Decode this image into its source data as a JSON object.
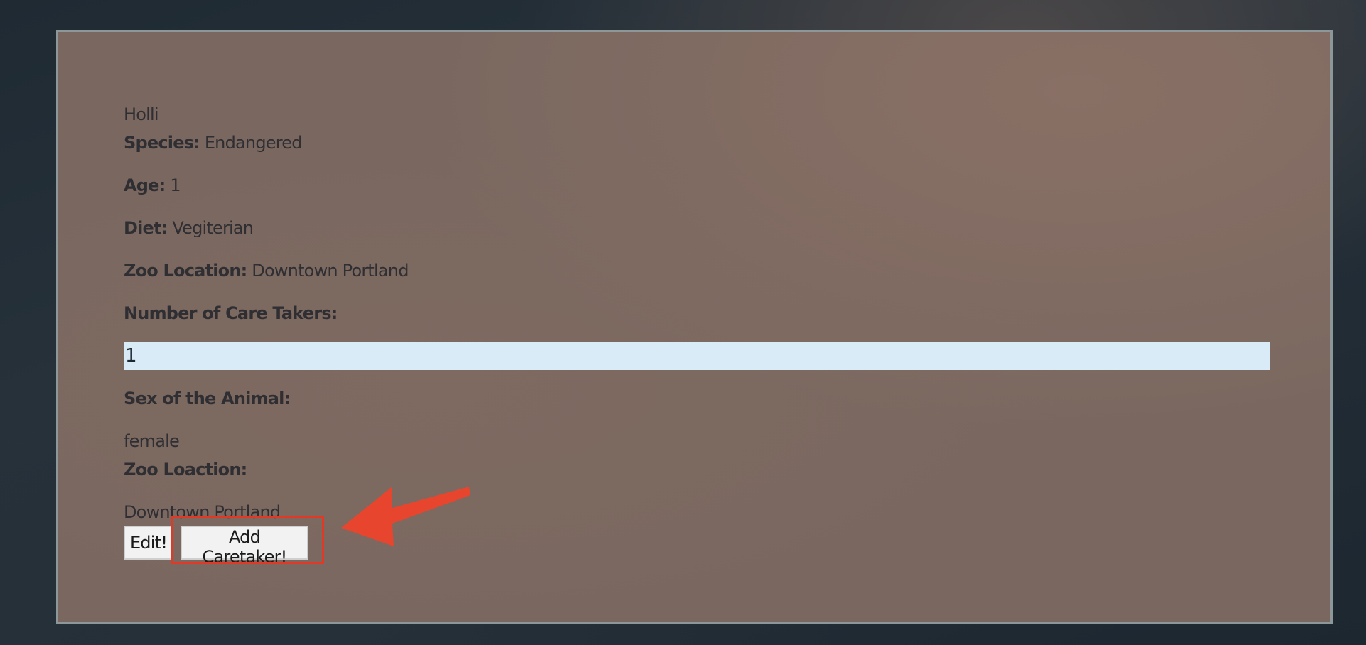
{
  "animal": {
    "name": "Holli",
    "species_label": "Species:",
    "species_value": "Endangered",
    "age_label": "Age:",
    "age_value": "1",
    "diet_label": "Diet:",
    "diet_value": "Vegiterian",
    "zoo_location_label": "Zoo Location:",
    "zoo_location_value": "Downtown Portland",
    "care_takers_label": "Number of Care Takers:",
    "care_takers_value": "1",
    "sex_label": "Sex of the Animal:",
    "sex_value": "female",
    "zoo_loaction_label": "Zoo Loaction:",
    "zoo_loaction_value": "Downtown Portland"
  },
  "actions": {
    "edit_label": "Edit!",
    "add_caretaker_label": "Add Caretaker!"
  },
  "colors": {
    "annotation": "#e03a26",
    "input_background": "#d9ebf6"
  },
  "icons": {
    "annotation_arrow": "arrow-icon"
  }
}
